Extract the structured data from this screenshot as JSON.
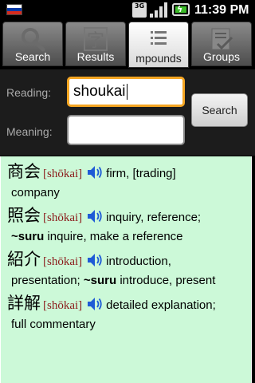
{
  "status_bar": {
    "network": "3G",
    "time": "11:39 PM",
    "flag_colors": [
      "#ffffff",
      "#0039a6",
      "#d52b1e"
    ]
  },
  "tabs": [
    {
      "label": "Search",
      "icon": "magnifier-icon",
      "selected": false
    },
    {
      "label": "Results",
      "icon": "kanji-card-icon",
      "kanji": "字",
      "selected": false
    },
    {
      "label": "mpounds",
      "icon": "list-icon",
      "selected": true
    },
    {
      "label": "Groups",
      "icon": "checklist-icon",
      "selected": false
    }
  ],
  "search": {
    "reading_label": "Reading:",
    "reading_value": "shoukai",
    "meaning_label": "Meaning:",
    "meaning_value": "",
    "button_label": "Search"
  },
  "results": [
    {
      "kanji": "商会",
      "reading": "[shōkai]",
      "meaning_line1": "firm, [trading]",
      "meaning_line2": "company"
    },
    {
      "kanji": "照会",
      "reading": "[shōkai]",
      "meaning_line1": "inquiry, reference;",
      "meaning_bold": "~suru",
      "meaning_line2": " inquire, make a reference"
    },
    {
      "kanji": "紹介",
      "reading": "[shōkai]",
      "meaning_line1": "introduction,",
      "meaning_line2a": "presentation; ",
      "meaning_bold": "~suru",
      "meaning_line2b": " introduce, present"
    },
    {
      "kanji": "詳解",
      "reading": "[shōkai]",
      "meaning_line1": "detailed explanation;",
      "meaning_line2": "full commentary"
    }
  ],
  "colors": {
    "results_bg": "#ccf9d8",
    "reading_text": "#8b1a1a",
    "focus_border": "#f5a623",
    "speaker": "#1e5bd6"
  }
}
